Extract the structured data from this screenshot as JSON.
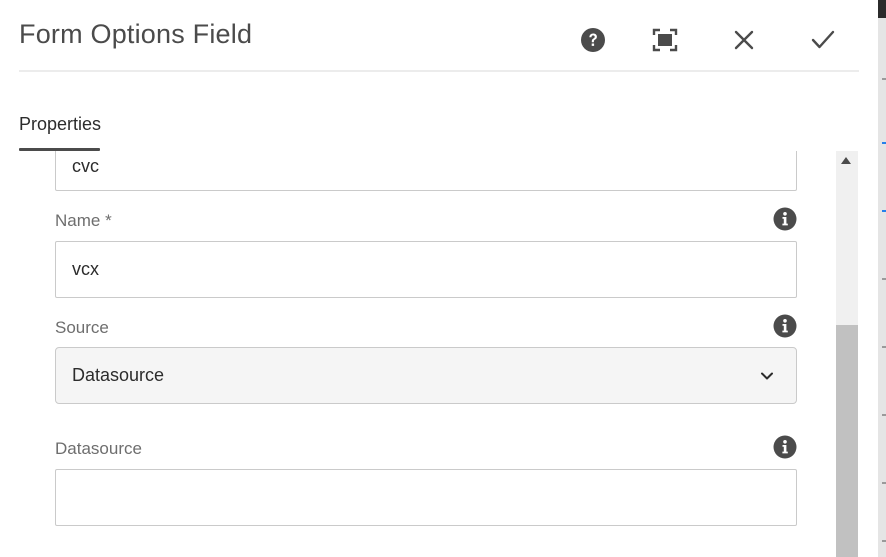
{
  "dialog": {
    "title": "Form Options Field",
    "actions": {
      "help": "help-icon",
      "fullscreen": "fullscreen-icon",
      "close": "close-icon",
      "done": "checkmark-icon"
    }
  },
  "tabs": [
    {
      "label": "Properties",
      "active": true
    }
  ],
  "fields": {
    "title_value": "cvc",
    "name_label": "Name *",
    "name_value": "vcx",
    "source_label": "Source",
    "source_value": "Datasource",
    "datasource_label": "Datasource",
    "datasource_value": ""
  },
  "colors": {
    "text": "#4b4b4b",
    "border": "#cacaca",
    "select_bg": "#f5f5f5",
    "accent": "#2680eb"
  }
}
